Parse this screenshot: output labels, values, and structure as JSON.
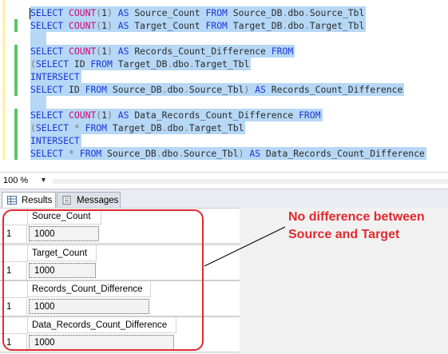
{
  "editor": {
    "lines": [
      [
        {
          "t": "SELECT",
          "c": "kw"
        },
        {
          "t": " "
        },
        {
          "t": "COUNT",
          "c": "fn"
        },
        {
          "t": "(",
          "c": "gr"
        },
        {
          "t": "1"
        },
        {
          "t": ")",
          "c": "gr"
        },
        {
          "t": " "
        },
        {
          "t": "AS",
          "c": "kw"
        },
        {
          "t": " Source_Count "
        },
        {
          "t": "FROM",
          "c": "kw"
        },
        {
          "t": " Source_DB"
        },
        {
          "t": ".",
          "c": "gr"
        },
        {
          "t": "dbo"
        },
        {
          "t": ".",
          "c": "gr"
        },
        {
          "t": "Source_Tbl"
        }
      ],
      [
        {
          "t": "SELECT",
          "c": "kw"
        },
        {
          "t": " "
        },
        {
          "t": "COUNT",
          "c": "fn"
        },
        {
          "t": "(",
          "c": "gr"
        },
        {
          "t": "1"
        },
        {
          "t": ")",
          "c": "gr"
        },
        {
          "t": " "
        },
        {
          "t": "AS",
          "c": "kw"
        },
        {
          "t": " Target_Count "
        },
        {
          "t": "FROM",
          "c": "kw"
        },
        {
          "t": " Target_DB"
        },
        {
          "t": ".",
          "c": "gr"
        },
        {
          "t": "dbo"
        },
        {
          "t": ".",
          "c": "gr"
        },
        {
          "t": "Target_Tbl"
        }
      ],
      [],
      [
        {
          "t": "SELECT",
          "c": "kw"
        },
        {
          "t": " "
        },
        {
          "t": "COUNT",
          "c": "fn"
        },
        {
          "t": "(",
          "c": "gr"
        },
        {
          "t": "1"
        },
        {
          "t": ")",
          "c": "gr"
        },
        {
          "t": " "
        },
        {
          "t": "AS",
          "c": "kw"
        },
        {
          "t": " Records_Count_Difference "
        },
        {
          "t": "FROM",
          "c": "kw"
        }
      ],
      [
        {
          "t": "(",
          "c": "gr"
        },
        {
          "t": "SELECT",
          "c": "kw"
        },
        {
          "t": " ID "
        },
        {
          "t": "FROM",
          "c": "kw"
        },
        {
          "t": " Target_DB"
        },
        {
          "t": ".",
          "c": "gr"
        },
        {
          "t": "dbo"
        },
        {
          "t": ".",
          "c": "gr"
        },
        {
          "t": "Target_Tbl"
        }
      ],
      [
        {
          "t": "INTERSECT",
          "c": "kw"
        }
      ],
      [
        {
          "t": "SELECT",
          "c": "kw"
        },
        {
          "t": " ID "
        },
        {
          "t": "FROM",
          "c": "kw"
        },
        {
          "t": " Source_DB"
        },
        {
          "t": ".",
          "c": "gr"
        },
        {
          "t": "dbo"
        },
        {
          "t": ".",
          "c": "gr"
        },
        {
          "t": "Source_Tbl"
        },
        {
          "t": ")",
          "c": "gr"
        },
        {
          "t": " "
        },
        {
          "t": "AS",
          "c": "kw"
        },
        {
          "t": " Records_Count_Difference"
        }
      ],
      [],
      [
        {
          "t": "SELECT",
          "c": "kw"
        },
        {
          "t": " "
        },
        {
          "t": "COUNT",
          "c": "fn"
        },
        {
          "t": "(",
          "c": "gr"
        },
        {
          "t": "1"
        },
        {
          "t": ")",
          "c": "gr"
        },
        {
          "t": " "
        },
        {
          "t": "AS",
          "c": "kw"
        },
        {
          "t": " Data_Records_Count_Difference "
        },
        {
          "t": "FROM",
          "c": "kw"
        }
      ],
      [
        {
          "t": "(",
          "c": "gr"
        },
        {
          "t": "SELECT",
          "c": "kw"
        },
        {
          "t": " "
        },
        {
          "t": "*",
          "c": "gr"
        },
        {
          "t": " "
        },
        {
          "t": "FROM",
          "c": "kw"
        },
        {
          "t": " Target_DB"
        },
        {
          "t": ".",
          "c": "gr"
        },
        {
          "t": "dbo"
        },
        {
          "t": ".",
          "c": "gr"
        },
        {
          "t": "Target_Tbl"
        }
      ],
      [
        {
          "t": "INTERSECT",
          "c": "kw"
        }
      ],
      [
        {
          "t": "SELECT",
          "c": "kw"
        },
        {
          "t": " "
        },
        {
          "t": "*",
          "c": "gr"
        },
        {
          "t": " "
        },
        {
          "t": "FROM",
          "c": "kw"
        },
        {
          "t": " Source_DB"
        },
        {
          "t": ".",
          "c": "gr"
        },
        {
          "t": "dbo"
        },
        {
          "t": ".",
          "c": "gr"
        },
        {
          "t": "Source_Tbl"
        },
        {
          "t": ")",
          "c": "gr"
        },
        {
          "t": " "
        },
        {
          "t": "AS",
          "c": "kw"
        },
        {
          "t": " Data_Records_Count_Difference"
        }
      ]
    ],
    "colors": {
      "keyword": "#1a36d9",
      "function": "#d5006e",
      "operator": "#7b7b7b",
      "selection": "#b6d7f5",
      "change_marker": "#5cc36a"
    }
  },
  "zoom": {
    "value": "100 %",
    "arrow_icon": "dropdown-arrow-icon"
  },
  "tabs": [
    {
      "label": "Results",
      "icon": "results-grid-icon",
      "active": true
    },
    {
      "label": "Messages",
      "icon": "messages-icon",
      "active": false
    }
  ],
  "results": [
    {
      "column": "Source_Count",
      "row_number": "1",
      "value": "1000"
    },
    {
      "column": "Target_Count",
      "row_number": "1",
      "value": "1000"
    },
    {
      "column": "Records_Count_Difference",
      "row_number": "1",
      "value": "1000"
    },
    {
      "column": "Data_Records_Count_Difference",
      "row_number": "1",
      "value": "1000"
    }
  ],
  "annotation": {
    "line1": "No difference between",
    "line2": "Source and Target",
    "color": "#e02a30"
  }
}
